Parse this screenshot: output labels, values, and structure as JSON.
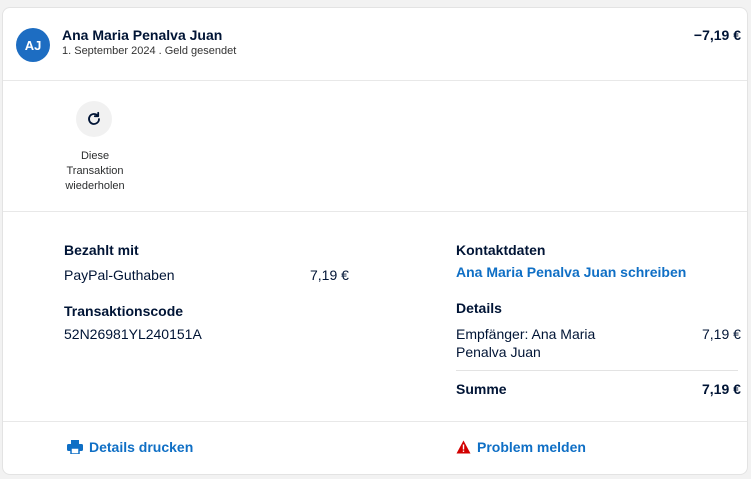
{
  "header": {
    "avatar_initials": "AJ",
    "name": "Ana Maria Penalva Juan",
    "subline": "1. September 2024 . Geld gesendet",
    "amount": "−7,19 €"
  },
  "repeat": {
    "icon": "refresh-icon",
    "label": "Diese Transaktion wiederholen"
  },
  "paid_with": {
    "heading": "Bezahlt mit",
    "method": "PayPal-Guthaben",
    "amount": "7,19 €"
  },
  "transaction": {
    "heading": "Transaktionscode",
    "code": "52N26981YL240151A"
  },
  "contact": {
    "heading": "Kontaktdaten",
    "link": "Ana Maria Penalva Juan schreiben"
  },
  "details": {
    "heading": "Details",
    "recipient_line1": "Empfänger: Ana Maria",
    "recipient_line2": "Penalva Juan",
    "recipient_amount": "7,19 €",
    "sum_label": "Summe",
    "sum_amount": "7,19 €"
  },
  "footer": {
    "print_icon": "printer-icon",
    "print_label": "Details drucken",
    "report_icon": "warning-icon",
    "report_label": "Problem melden"
  },
  "colors": {
    "link_blue": "#0f6fc5",
    "danger_red": "#d20000",
    "avatar_blue": "#1d6dc2"
  }
}
